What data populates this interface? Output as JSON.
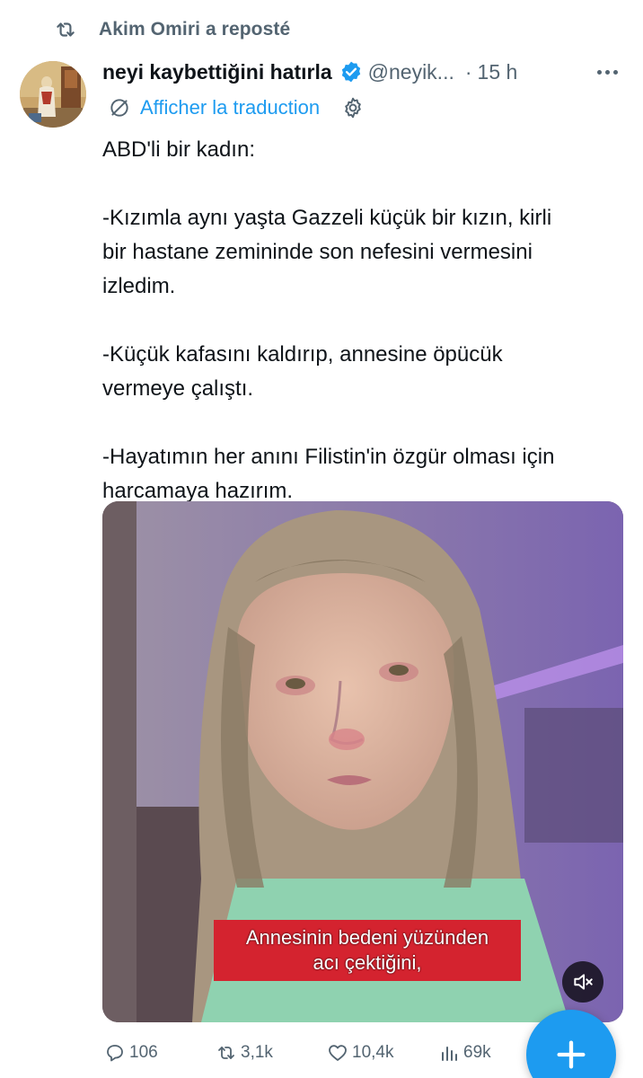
{
  "repost": {
    "icon": "repost-icon",
    "text": "Akim Omiri a reposté"
  },
  "author": {
    "display_name": "neyi kaybettiğini hatırla",
    "handle": "@neyik...",
    "separator": "·",
    "time": "15 h",
    "verified": true,
    "avatar": "avatar-painting"
  },
  "translate": {
    "label": "Afficher la traduction",
    "icon": "translate-icon",
    "settings_icon": "gear-icon"
  },
  "tweet": {
    "paragraphs": [
      "ABD'li bir kadın:",
      "-Kızımla aynı yaşta Gazzeli küçük bir kızın, kirli\nbir hastane zemininde son nefesini vermesini\nizledim.",
      "-Küçük kafasını kaldırıp, annesine öpücük\nvermeye çalıştı.",
      "-Hayatımın her anını Filistin'in özgür olması için\nharcamaya hazırım."
    ]
  },
  "media": {
    "type": "video",
    "caption_lines": [
      "Annesinin bedeni yüzünden",
      "acı çektiğini,"
    ],
    "mute_icon": "volume-muted-icon"
  },
  "actions": {
    "replies": "106",
    "reposts": "3,1k",
    "likes": "10,4k",
    "views": "69k"
  },
  "fab": {
    "icon": "plus-icon"
  },
  "colors": {
    "accent": "#1d9bf0",
    "secondary_text": "#536471",
    "caption_bg": "#d4232f"
  }
}
